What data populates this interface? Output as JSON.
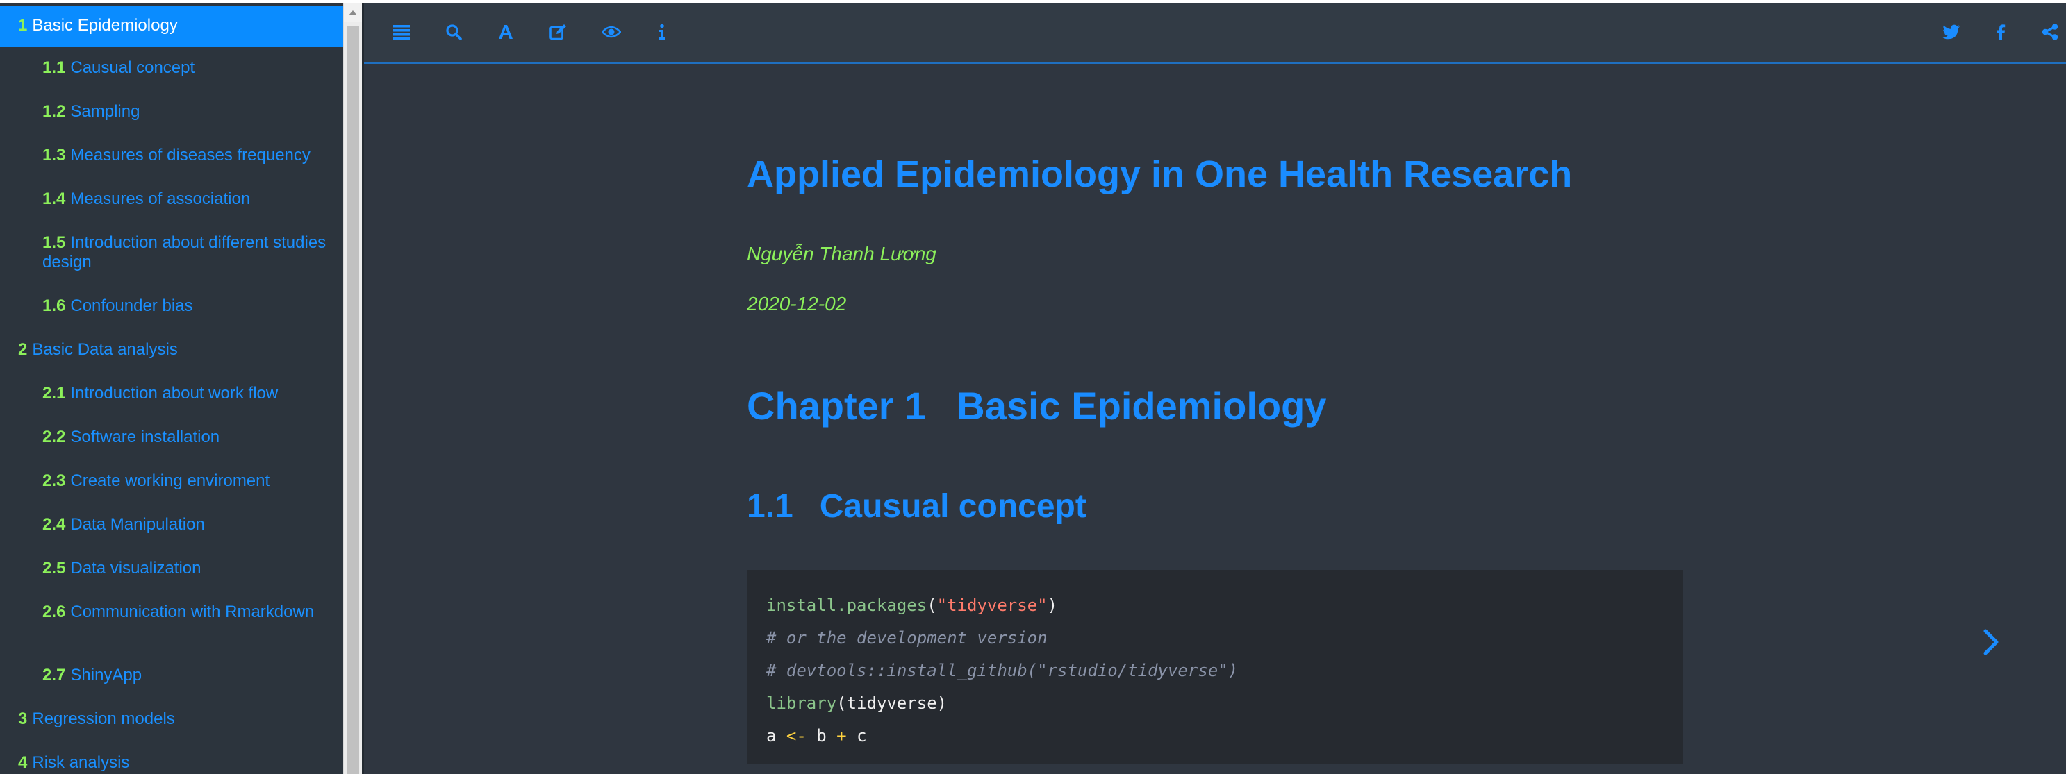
{
  "toc": [
    {
      "num": "1",
      "label": "Basic Epidemiology",
      "active": true
    },
    {
      "num": "1.1",
      "label": "Causual concept"
    },
    {
      "num": "1.2",
      "label": "Sampling"
    },
    {
      "num": "1.3",
      "label": "Measures of diseases frequency"
    },
    {
      "num": "1.4",
      "label": "Measures of association"
    },
    {
      "num": "1.5",
      "label": "Introduction about different studies design"
    },
    {
      "num": "1.6",
      "label": "Confounder bias"
    },
    {
      "num": "2",
      "label": "Basic Data analysis"
    },
    {
      "num": "2.1",
      "label": "Introduction about work flow"
    },
    {
      "num": "2.2",
      "label": "Software installation"
    },
    {
      "num": "2.3",
      "label": "Create working enviroment"
    },
    {
      "num": "2.4",
      "label": "Data Manipulation"
    },
    {
      "num": "2.5",
      "label": "Data visualization"
    },
    {
      "num": "2.6",
      "label": "Communication with Rmarkdown"
    },
    {
      "num": "2.7",
      "label": "ShinyApp"
    },
    {
      "num": "3",
      "label": "Regression models"
    },
    {
      "num": "4",
      "label": "Risk analysis"
    }
  ],
  "toolbar": {
    "left_icons": [
      "toc-icon",
      "search-icon",
      "font-icon",
      "edit-icon",
      "eye-icon",
      "info-icon"
    ],
    "right_icons": [
      "twitter-icon",
      "facebook-icon",
      "share-icon"
    ]
  },
  "content": {
    "title": "Applied Epidemiology in One Health Research",
    "author": "Nguyễn Thanh Lương",
    "date": "2020-12-02",
    "chapter_num": "Chapter 1",
    "chapter_title": "Basic Epidemiology",
    "section_num": "1.1",
    "section_title": "Causual concept",
    "code": {
      "l1_fn": "install.packages",
      "l1_open": "(",
      "l1_str": "\"tidyverse\"",
      "l1_close": ")",
      "l2": "# or the development version",
      "l3": "# devtools::install_github(\"rstudio/tidyverse\")",
      "l4_fn": "library",
      "l4_rest": "(tidyverse)",
      "l5_a": "a ",
      "l5_op1": "<-",
      "l5_b": " b ",
      "l5_op2": "+",
      "l5_c": " c"
    }
  },
  "colors": {
    "accent": "#1a8cff",
    "number_green": "#8cf05a",
    "active_bg": "#0a8cff",
    "sidebar_bg": "#2c343d",
    "content_bg": "#2f3640",
    "code_bg": "#262a30"
  }
}
